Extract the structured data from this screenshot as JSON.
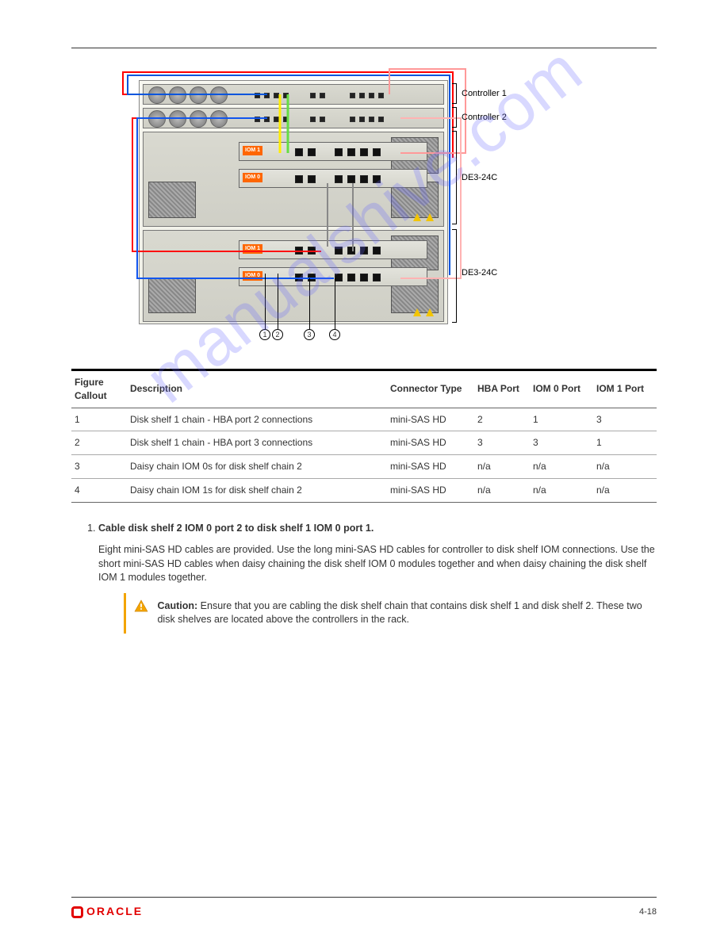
{
  "figure": {
    "right_labels": {
      "controller1": "Controller 1",
      "controller2": "Controller 2",
      "de31": "DE3-24C",
      "de32": "DE3-24C"
    },
    "callouts": {
      "c1": "1",
      "c2": "2",
      "c3": "3",
      "c4": "4"
    },
    "iom_labels": {
      "iom1": "IOM 1",
      "iom0": "IOM 0"
    }
  },
  "table": {
    "headers": {
      "callout": "Figure Callout",
      "desc": "Description",
      "conn": "Connector Type",
      "hba": "HBA Port",
      "iom0": "IOM 0 Port",
      "iom1": "IOM 1 Port"
    },
    "rows": [
      {
        "callout": "1",
        "desc": "Disk shelf 1 chain - HBA port 2 connections",
        "conn": "mini-SAS HD",
        "hba": "2",
        "iom0": "1",
        "iom1": "3"
      },
      {
        "callout": "2",
        "desc": "Disk shelf 1 chain - HBA port 3 connections",
        "conn": "mini-SAS HD",
        "hba": "3",
        "iom0": "3",
        "iom1": "1"
      },
      {
        "callout": "3",
        "desc": "Daisy chain IOM 0s for disk shelf chain 2",
        "conn": "mini-SAS HD",
        "hba": "n/a",
        "iom0": "n/a",
        "iom1": "n/a"
      },
      {
        "callout": "4",
        "desc": "Daisy chain IOM 1s for disk shelf chain 2",
        "conn": "mini-SAS HD",
        "hba": "n/a",
        "iom0": "n/a",
        "iom1": "n/a"
      }
    ]
  },
  "steps": {
    "item1_title": "Cable disk shelf 2 IOM 0 port 2 to disk shelf 1 IOM 0 port 1.",
    "item1_body": "Eight mini-SAS HD cables are provided. Use the long mini-SAS HD cables for controller to disk shelf IOM connections. Use the short mini-SAS HD cables when daisy chaining the disk shelf IOM 0 modules together and when daisy chaining the disk shelf IOM 1 modules together."
  },
  "caution": {
    "label": "Caution:",
    "text": "Ensure that you are cabling the disk shelf chain that contains disk shelf 1 and disk shelf 2. These two disk shelves are located above the controllers in the rack."
  },
  "watermark": "manualshive.com",
  "footer": {
    "page": "4-18"
  }
}
